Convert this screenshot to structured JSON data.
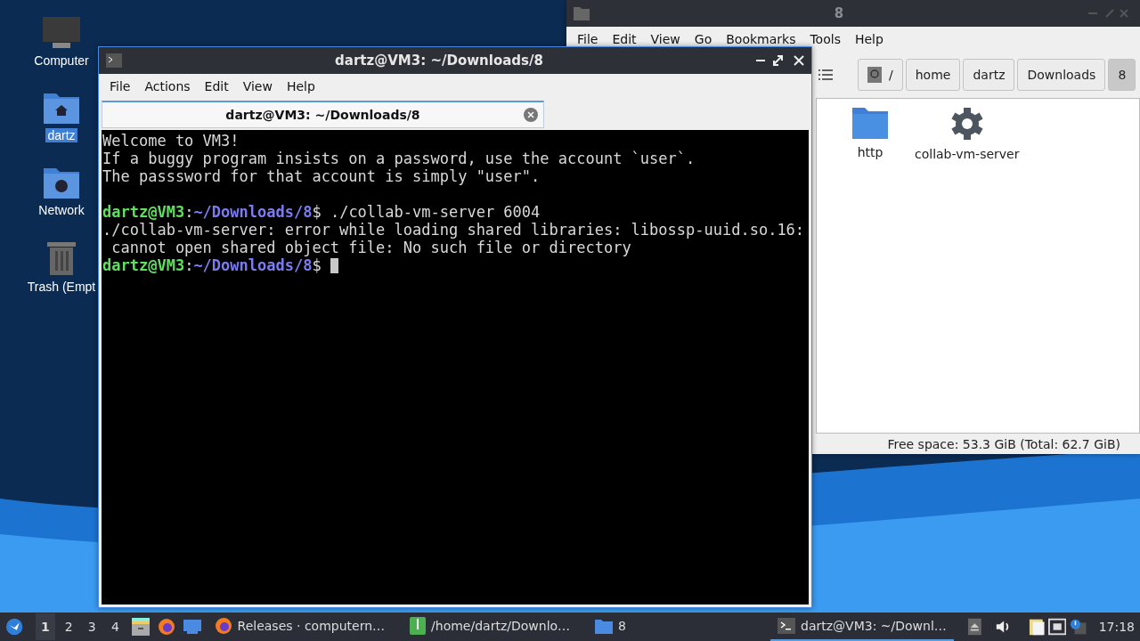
{
  "desktop": {
    "icons": [
      {
        "label": "Computer",
        "kind": "computer",
        "selected": false
      },
      {
        "label": "dartz",
        "kind": "home",
        "selected": true
      },
      {
        "label": "Network",
        "kind": "network",
        "selected": false
      },
      {
        "label": "Trash (Empt",
        "kind": "trash",
        "selected": false
      }
    ]
  },
  "file_manager": {
    "title": "8",
    "menu": [
      "File",
      "Edit",
      "View",
      "Go",
      "Bookmarks",
      "Tools",
      "Help"
    ],
    "path": [
      {
        "label": "/",
        "kind": "root",
        "selected": false
      },
      {
        "label": "home",
        "kind": "dir",
        "selected": false
      },
      {
        "label": "dartz",
        "kind": "dir",
        "selected": false
      },
      {
        "label": "Downloads",
        "kind": "dir",
        "selected": false
      },
      {
        "label": "8",
        "kind": "dir",
        "selected": true
      }
    ],
    "items": [
      {
        "name": "http",
        "kind": "folder"
      },
      {
        "name": "collab-vm-server",
        "kind": "executable"
      }
    ],
    "status": "Free space: 53.3 GiB (Total: 62.7 GiB)"
  },
  "terminal": {
    "title": "dartz@VM3: ~/Downloads/8",
    "menu": [
      "File",
      "Actions",
      "Edit",
      "View",
      "Help"
    ],
    "tab": "dartz@VM3: ~/Downloads/8",
    "lines": [
      {
        "segments": [
          {
            "kind": "text",
            "text": "Welcome to VM3!"
          }
        ]
      },
      {
        "segments": [
          {
            "kind": "text",
            "text": "If a buggy program insists on a password, use the account `user`."
          }
        ]
      },
      {
        "segments": [
          {
            "kind": "text",
            "text": "The passsword for that account is simply \"user\"."
          }
        ]
      },
      {
        "gap_before": true,
        "segments": [
          {
            "kind": "user",
            "text": "dartz@VM3"
          },
          {
            "kind": "text",
            "text": ":"
          },
          {
            "kind": "path",
            "text": "~/Downloads/8"
          },
          {
            "kind": "text",
            "text": "$ ./collab-vm-server 6004"
          }
        ]
      },
      {
        "segments": [
          {
            "kind": "text",
            "text": "./collab-vm-server: error while loading shared libraries: libossp-uuid.so.16:"
          }
        ]
      },
      {
        "segments": [
          {
            "kind": "text",
            "text": " cannot open shared object file: No such file or directory"
          }
        ]
      },
      {
        "cursor": true,
        "segments": [
          {
            "kind": "user",
            "text": "dartz@VM3"
          },
          {
            "kind": "text",
            "text": ":"
          },
          {
            "kind": "path",
            "text": "~/Downloads/8"
          },
          {
            "kind": "text",
            "text": "$ "
          }
        ]
      }
    ]
  },
  "taskbar": {
    "workspaces": [
      {
        "label": "1",
        "selected": true
      },
      {
        "label": "2",
        "selected": false
      },
      {
        "label": "3",
        "selected": false
      },
      {
        "label": "4",
        "selected": false
      }
    ],
    "launchers": [
      {
        "kind": "cabinet"
      },
      {
        "kind": "firefox"
      },
      {
        "kind": "desktop"
      }
    ],
    "tasks": [
      {
        "label": "Releases · computern…",
        "kind": "firefox",
        "selected": false
      },
      {
        "label": "/home/dartz/Downlo…",
        "kind": "archive",
        "selected": false
      },
      {
        "label": "8",
        "kind": "folder",
        "selected": false
      },
      {
        "label": "dartz@VM3: ~/Downl…",
        "kind": "terminal",
        "selected": true
      }
    ],
    "clock": "17:18"
  }
}
